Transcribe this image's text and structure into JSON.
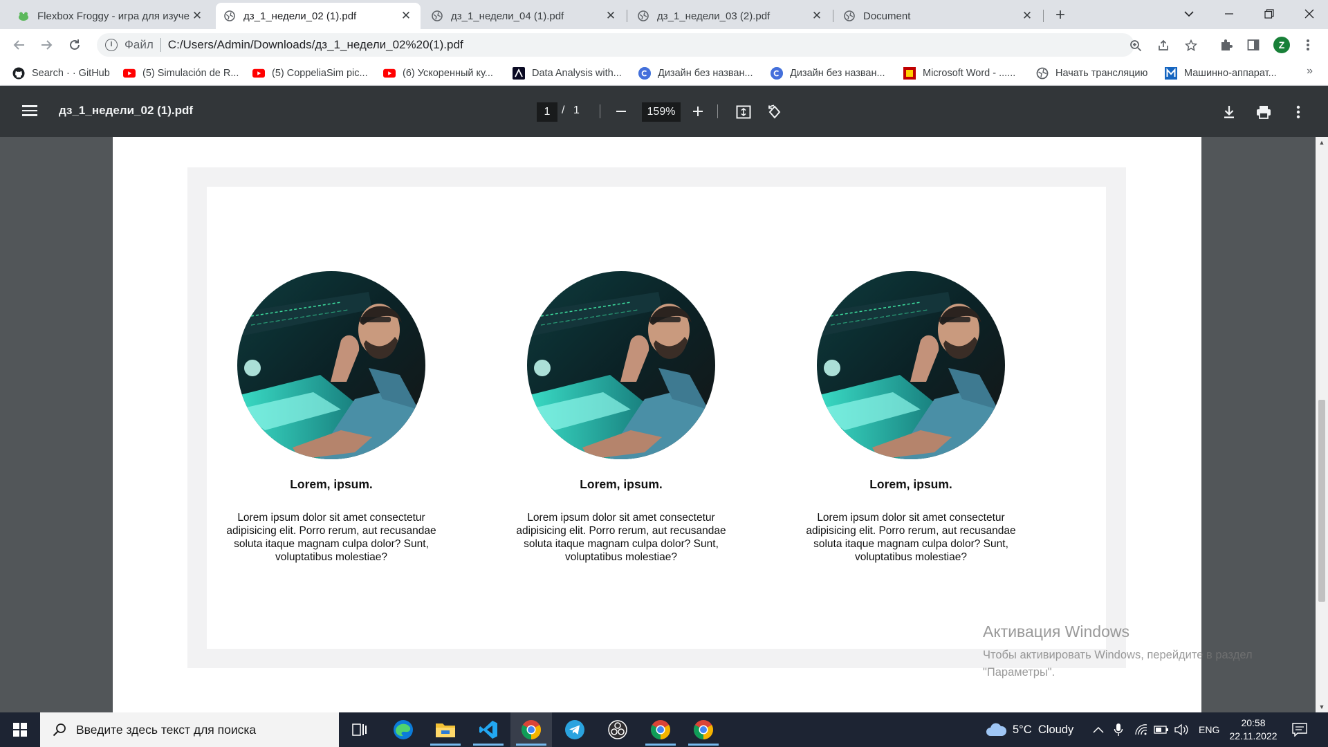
{
  "browser": {
    "tabs": [
      {
        "title": "Flexbox Froggy - игра для изуче",
        "favicon": "frog-icon",
        "active": false
      },
      {
        "title": "дз_1_недели_02 (1).pdf",
        "favicon": "globe-icon",
        "active": true
      },
      {
        "title": "дз_1_недели_04 (1).pdf",
        "favicon": "globe-icon",
        "active": false
      },
      {
        "title": "дз_1_недели_03 (2).pdf",
        "favicon": "globe-icon",
        "active": false
      },
      {
        "title": "Document",
        "favicon": "globe-icon",
        "active": false
      }
    ],
    "address": {
      "scheme_label": "Файл",
      "url": "C:/Users/Admin/Downloads/дз_1_недели_02%20(1).pdf"
    },
    "profile_initial": "Z",
    "bookmarks": [
      {
        "label": "Search · · GitHub",
        "icon": "github-icon"
      },
      {
        "label": "(5) Simulación de R...",
        "icon": "youtube-icon"
      },
      {
        "label": "(5) CoppeliaSim pic...",
        "icon": "youtube-icon"
      },
      {
        "label": "(6) Ускоренный ку...",
        "icon": "youtube-icon"
      },
      {
        "label": "Data Analysis with...",
        "icon": "data-analysis-icon"
      },
      {
        "label": "Дизайн без назван...",
        "icon": "canva-icon"
      },
      {
        "label": "Дизайн без назван...",
        "icon": "canva-icon"
      },
      {
        "label": "Microsoft Word - ......",
        "icon": "document-icon"
      },
      {
        "label": "Начать трансляцию",
        "icon": "broadcast-icon"
      },
      {
        "label": "Машинно-аппарат...",
        "icon": "m-logo-icon"
      }
    ],
    "bookmarks_more": "»"
  },
  "pdf_viewer": {
    "filename": "дз_1_недели_02 (1).pdf",
    "current_page": "1",
    "page_separator": "/",
    "total_pages": "1",
    "zoom": "159%"
  },
  "document": {
    "cards": [
      {
        "title": "Lorem, ipsum.",
        "text": "Lorem ipsum dolor sit amet consectetur adipisicing elit. Porro rerum, aut recusandae soluta itaque magnam culpa dolor? Sunt, voluptatibus molestiae?"
      },
      {
        "title": "Lorem, ipsum.",
        "text": "Lorem ipsum dolor sit amet consectetur adipisicing elit. Porro rerum, aut recusandae soluta itaque magnam culpa dolor? Sunt, voluptatibus molestiae?"
      },
      {
        "title": "Lorem, ipsum.",
        "text": "Lorem ipsum dolor sit amet consectetur adipisicing elit. Porro rerum, aut recusandae soluta itaque magnam culpa dolor? Sunt, voluptatibus molestiae?"
      }
    ]
  },
  "watermark": {
    "title": "Активация Windows",
    "text": "Чтобы активировать Windows, перейдите в раздел \"Параметры\"."
  },
  "taskbar": {
    "search_placeholder": "Введите здесь текст для поиска",
    "weather": "5°C  Cloudy",
    "language": "ENG",
    "time": "20:58",
    "date": "22.11.2022"
  }
}
